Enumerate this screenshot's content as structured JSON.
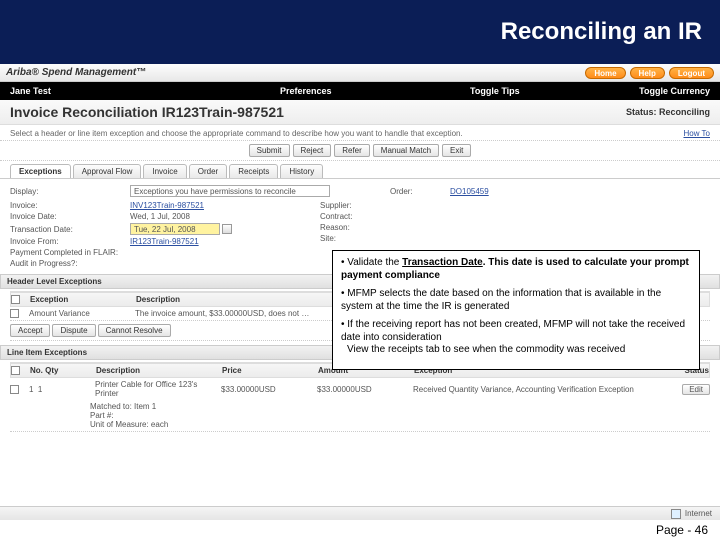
{
  "slide": {
    "title": "Reconciling an IR",
    "footer": "Page - 46"
  },
  "ariba": {
    "brand": "Ariba® Spend Management™",
    "buttons": {
      "home": "Home",
      "help": "Help",
      "logout": "Logout"
    }
  },
  "nav": {
    "user": "Jane Test",
    "prefs": "Preferences",
    "tips": "Toggle Tips",
    "currency": "Toggle Currency"
  },
  "page": {
    "title": "Invoice Reconciliation IR123Train-987521",
    "status_label": "Status:",
    "status_value": "Reconciling",
    "instruction": "Select a header or line item exception and choose the appropriate command to describe how you want to handle that exception.",
    "howto": "How To"
  },
  "actions": {
    "submit": "Submit",
    "reject": "Reject",
    "refer": "Refer",
    "manualmatch": "Manual Match",
    "exit": "Exit"
  },
  "tabs": [
    "Exceptions",
    "Approval Flow",
    "Invoice",
    "Order",
    "Receipts",
    "History"
  ],
  "summary": {
    "display_label": "Display:",
    "display_value": "Exceptions you have permissions to reconcile",
    "fields_left": {
      "invoice_label": "Invoice:",
      "invoice_value": "INV123Train-987521",
      "invoice_date_label": "Invoice Date:",
      "invoice_date_value": "Wed, 1 Jul, 2008",
      "transaction_date_label": "Transaction Date:",
      "transaction_date_value": "Tue, 22 Jul, 2008",
      "invoice_from_label": "Invoice From:",
      "invoice_from_value": "IR123Train-987521",
      "payment_completed_label": "Payment Completed in FLAIR:",
      "payment_completed_value": "",
      "audit_label": "Audit in Progress?:",
      "audit_value": ""
    },
    "fields_right": {
      "order_label": "Order:",
      "order_value": "DO105459",
      "supplier_label": "Supplier:",
      "contract_label": "Contract:",
      "reason_label": "Reason:",
      "site_label": "Site:"
    }
  },
  "header_exceptions": {
    "title": "Header Level Exceptions",
    "col_exception": "Exception",
    "col_description": "Description",
    "row_exception": "Amount Variance",
    "row_description": "The invoice amount, $33.00000USD, does not …",
    "btn_accept": "Accept",
    "btn_dispute": "Dispute",
    "btn_cannot": "Cannot Resolve"
  },
  "line_exceptions": {
    "title": "Line Item Exceptions",
    "col_no": "No.",
    "col_qty": "Qty",
    "col_desc": "Description",
    "col_price": "Price",
    "col_amount": "Amount",
    "col_exception": "Exception",
    "col_status": "Status",
    "row": {
      "no": "1",
      "qty": "1",
      "desc": "Printer Cable for Office 123's Printer",
      "price": "$33.00000USD",
      "amount": "$33.00000USD",
      "exception": "Received Quantity Variance, Accounting Verification Exception",
      "status": ""
    },
    "matched": "Matched to: Item 1",
    "part": "Part #:",
    "uom": "Unit of Measure: each",
    "edit": "Edit"
  },
  "statusbar": {
    "text": "Internet"
  },
  "callout": {
    "b1_prefix": "• Validate the ",
    "b1_strong": "Transaction Date",
    "b1_suffix": ". This date is used to calculate your prompt payment compliance",
    "b2": "• MFMP selects the date based on the information that is available in the system at the time the IR is generated",
    "b3a": "• If the receiving report has not been created, MFMP will not take the received date into consideration",
    "b3b": "View the receipts tab to see when the commodity was received"
  }
}
